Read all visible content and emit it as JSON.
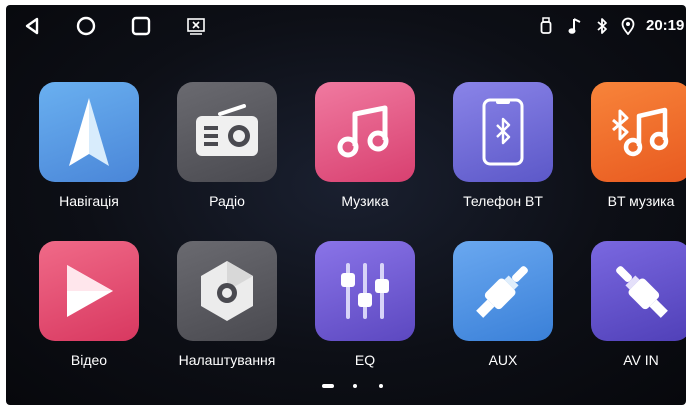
{
  "statusbar": {
    "time": "20:19",
    "nav_buttons": [
      "back-icon",
      "home-icon",
      "recents-icon",
      "screen-mirror-icon"
    ],
    "status_icons": [
      "usb-icon",
      "music-note-icon",
      "bluetooth-icon",
      "location-icon"
    ]
  },
  "apps": [
    {
      "label": "Навігація",
      "icon": "navigation-icon",
      "color": "#5a9ae8"
    },
    {
      "label": "Радіо",
      "icon": "radio-icon",
      "color": "#5c5c62"
    },
    {
      "label": "Музика",
      "icon": "music-icon",
      "color": "#e8507a"
    },
    {
      "label": "Телефон BT",
      "icon": "bluetooth-phone-icon",
      "color": "#6a6ad8"
    },
    {
      "label": "BT музика",
      "icon": "bluetooth-music-icon",
      "color": "#f06a2e"
    },
    {
      "label": "Відео",
      "icon": "play-icon",
      "color": "#e8486a"
    },
    {
      "label": "Налаштування",
      "icon": "settings-icon",
      "color": "#5c5c62"
    },
    {
      "label": "EQ",
      "icon": "equalizer-icon",
      "color": "#6a58d0"
    },
    {
      "label": "AUX",
      "icon": "aux-jack-icon",
      "color": "#4a90e0"
    },
    {
      "label": "AV IN",
      "icon": "av-jack-icon",
      "color": "#6a58d0"
    }
  ],
  "pager": {
    "current_page": 1,
    "page_count": 3
  }
}
